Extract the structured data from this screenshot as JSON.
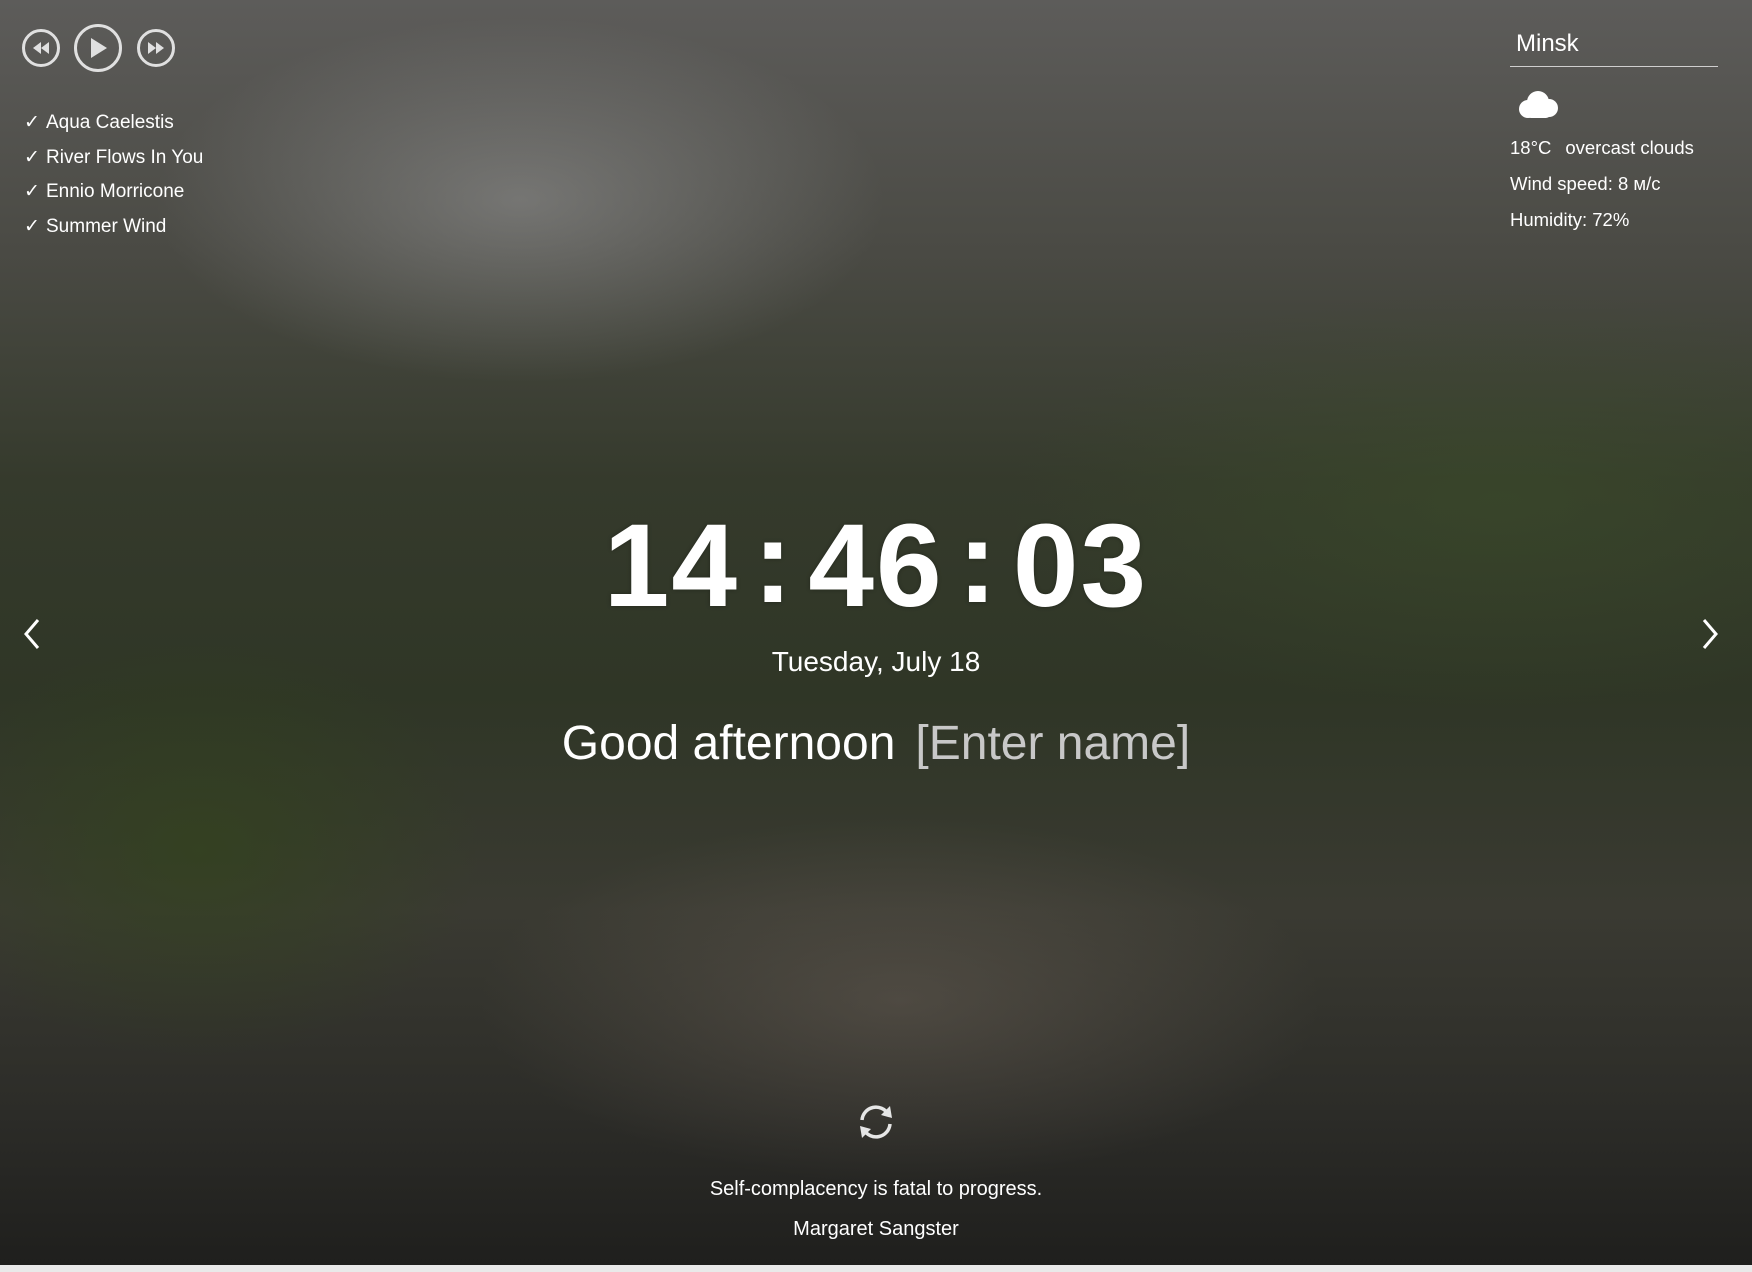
{
  "player": {
    "prev_icon": "rewind-icon",
    "play_icon": "play-icon",
    "next_icon": "fast-forward-icon",
    "playlist": [
      {
        "title": "Aqua Caelestis",
        "mark": "✓"
      },
      {
        "title": "River Flows In You",
        "mark": "✓"
      },
      {
        "title": "Ennio Morricone",
        "mark": "✓"
      },
      {
        "title": "Summer Wind",
        "mark": "✓"
      }
    ]
  },
  "weather": {
    "city": "Minsk",
    "icon": "cloud-icon",
    "temperature": "18°C",
    "description": "overcast clouds",
    "wind": "Wind speed: 8 м/с",
    "humidity": "Humidity: 72%"
  },
  "clock": {
    "hours": "14",
    "minutes": "46",
    "seconds": "03",
    "separator": ":",
    "date": "Tuesday, July 18"
  },
  "greeting": {
    "text": "Good afternoon",
    "name_placeholder": "[Enter name]"
  },
  "quote": {
    "text": "Self-complacency is fatal to progress.",
    "author": "Margaret Sangster",
    "refresh_icon": "refresh-icon"
  },
  "slider": {
    "prev_icon": "chevron-left-icon",
    "next_icon": "chevron-right-icon"
  }
}
